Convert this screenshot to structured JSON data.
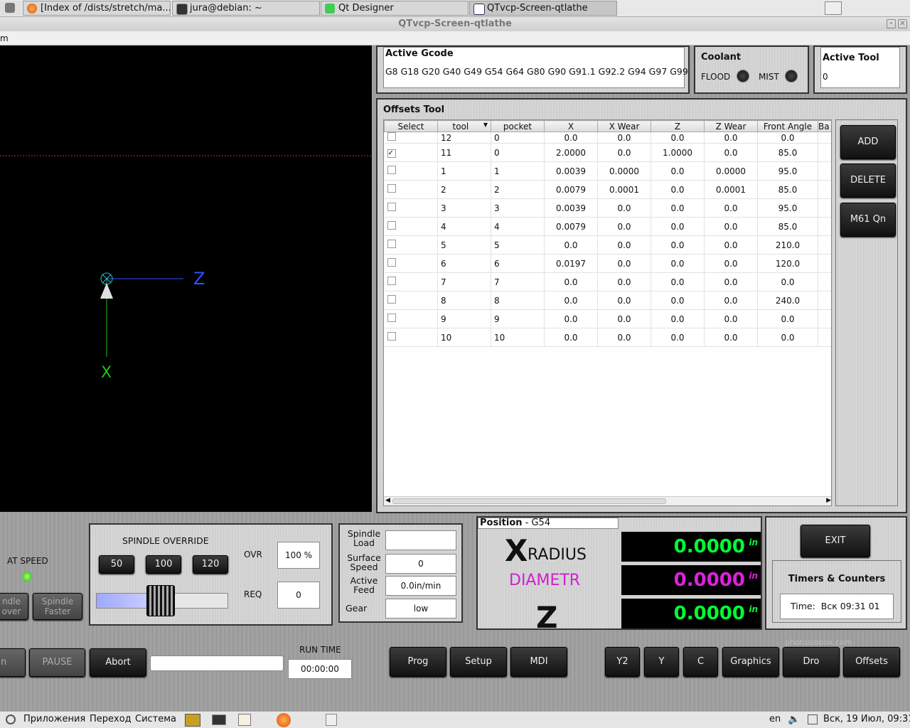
{
  "taskbar": {
    "tabs": [
      "[Index of /dists/stretch/ma...",
      "jura@debian: ~",
      "Qt Designer",
      "QTvcp-Screen-qtlathe"
    ]
  },
  "window": {
    "title": "QTvcp-Screen-qtlathe",
    "menu_fragment": "m"
  },
  "viewport": {
    "z_label": "Z",
    "x_label": "X"
  },
  "gcode": {
    "title": "Active Gcode",
    "codes": "G8 G18 G20 G40 G49 G54 G64 G80 G90 G91.1 G92.2 G94 G97 G99"
  },
  "coolant": {
    "title": "Coolant",
    "flood": "FLOOD",
    "mist": "MIST"
  },
  "active_tool": {
    "title": "Active Tool",
    "value": "0"
  },
  "offsets": {
    "title": "Offsets Tool",
    "headers": [
      "Select",
      "tool",
      "pocket",
      "X",
      "X Wear",
      "Z",
      "Z Wear",
      "Front Angle",
      "Ba"
    ],
    "rows": [
      {
        "checked": false,
        "tool": "12",
        "pocket": "0",
        "x": "0.0",
        "xw": "0.0",
        "z": "0.0",
        "zw": "0.0",
        "fa": "0.0"
      },
      {
        "checked": true,
        "tool": "11",
        "pocket": "0",
        "x": "2.0000",
        "xw": "0.0",
        "z": "1.0000",
        "zw": "0.0",
        "fa": "85.0"
      },
      {
        "checked": false,
        "tool": "1",
        "pocket": "1",
        "x": "0.0039",
        "xw": "0.0000",
        "z": "0.0",
        "zw": "0.0000",
        "fa": "95.0"
      },
      {
        "checked": false,
        "tool": "2",
        "pocket": "2",
        "x": "0.0079",
        "xw": "0.0001",
        "z": "0.0",
        "zw": "0.0001",
        "fa": "85.0"
      },
      {
        "checked": false,
        "tool": "3",
        "pocket": "3",
        "x": "0.0039",
        "xw": "0.0",
        "z": "0.0",
        "zw": "0.0",
        "fa": "95.0"
      },
      {
        "checked": false,
        "tool": "4",
        "pocket": "4",
        "x": "0.0079",
        "xw": "0.0",
        "z": "0.0",
        "zw": "0.0",
        "fa": "85.0"
      },
      {
        "checked": false,
        "tool": "5",
        "pocket": "5",
        "x": "0.0",
        "xw": "0.0",
        "z": "0.0",
        "zw": "0.0",
        "fa": "210.0"
      },
      {
        "checked": false,
        "tool": "6",
        "pocket": "6",
        "x": "0.0197",
        "xw": "0.0",
        "z": "0.0",
        "zw": "0.0",
        "fa": "120.0"
      },
      {
        "checked": false,
        "tool": "7",
        "pocket": "7",
        "x": "0.0",
        "xw": "0.0",
        "z": "0.0",
        "zw": "0.0",
        "fa": "0.0"
      },
      {
        "checked": false,
        "tool": "8",
        "pocket": "8",
        "x": "0.0",
        "xw": "0.0",
        "z": "0.0",
        "zw": "0.0",
        "fa": "240.0"
      },
      {
        "checked": false,
        "tool": "9",
        "pocket": "9",
        "x": "0.0",
        "xw": "0.0",
        "z": "0.0",
        "zw": "0.0",
        "fa": "0.0"
      },
      {
        "checked": false,
        "tool": "10",
        "pocket": "10",
        "x": "0.0",
        "xw": "0.0",
        "z": "0.0",
        "zw": "0.0",
        "fa": "0.0"
      }
    ],
    "buttons": {
      "add": "ADD",
      "delete": "DELETE",
      "m61": "M61 Qn"
    }
  },
  "spindle": {
    "at_speed": "AT SPEED",
    "slower": "ndle\nover",
    "faster": "Spindle\nFaster",
    "override_title": "SPINDLE OVERRIDE",
    "presets": [
      "50",
      "100",
      "120"
    ],
    "ovr_label": "OVR",
    "ovr_value": "100 %",
    "req_label": "REQ",
    "req_value": "0",
    "slider_fraction": 0.5
  },
  "spindle_info": {
    "load_label": "Spindle\nLoad",
    "load_value": "",
    "surface_label": "Surface\nSpeed",
    "surface_value": "0",
    "feed_label": "Active\nFeed",
    "feed_value": "0.0in/min",
    "gear_label": "Gear",
    "gear_value": "low"
  },
  "position": {
    "title": "Position",
    "coord": " - G54",
    "x_big": "X",
    "x_small": "RADIUS",
    "diam": "DIAMETR",
    "z_big": "Z",
    "x_value": "0.0000",
    "d_value": "0.0000",
    "z_value": "0.0000",
    "unit": "in"
  },
  "exit": {
    "label": "EXIT"
  },
  "timers": {
    "title": "Timers & Counters",
    "time_label": "Time:",
    "time_value": "Вск 09:31 01"
  },
  "controls": {
    "run_fragment": "n",
    "pause": "PAUSE",
    "abort": "Abort",
    "runtime_label": "RUN TIME",
    "runtime_value": "00:00:00",
    "tabs": [
      "Prog",
      "Setup",
      "MDI",
      "Y2",
      "Y",
      "C",
      "Graphics",
      "Dro",
      "Offsets"
    ],
    "watermark": "photosinbox.com"
  },
  "system": {
    "apps": "Приложения",
    "goto": "Переход",
    "system": "Система",
    "lang": "en",
    "clock": "Вск, 19 Июл, 09:31"
  }
}
